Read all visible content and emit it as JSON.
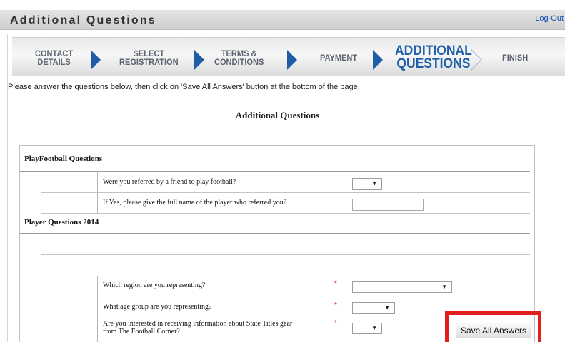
{
  "header": {
    "title": "Additional Questions",
    "logout_label": "Log-Out"
  },
  "steps": [
    {
      "line1": "CONTACT",
      "line2": "DETAILS",
      "active": false
    },
    {
      "line1": "SELECT",
      "line2": "REGISTRATION",
      "active": false
    },
    {
      "line1": "TERMS &",
      "line2": "CONDITIONS",
      "active": false
    },
    {
      "line1": "PAYMENT",
      "line2": "",
      "active": false
    },
    {
      "line1": "ADDITIONAL",
      "line2": "QUESTIONS",
      "active": true
    },
    {
      "line1": "FINISH",
      "line2": "",
      "active": false
    }
  ],
  "instructions": "Please answer the questions below, then click on 'Save All Answers' button at the bottom of the page.",
  "section_heading": "Additional Questions",
  "groups": [
    {
      "title": "PlayFootball Questions",
      "questions": [
        {
          "text": "Were you referred by a friend to play football?",
          "required": false,
          "input": "select",
          "value": ""
        },
        {
          "text": "If Yes, please give the full name of the player who referred you?",
          "required": false,
          "input": "text",
          "value": ""
        }
      ]
    },
    {
      "title": "Player Questions 2014",
      "questions": [
        {
          "text": "Which region are you representing?",
          "required": true,
          "input": "select",
          "value": ""
        },
        {
          "text": "What age group are you representing?",
          "required": true,
          "input": "select",
          "value": ""
        },
        {
          "text_line1": "Are you interested in receiving information about State Titles gear",
          "text_line2": "from The Football Corner?",
          "required": true,
          "input": "select",
          "value": ""
        }
      ]
    }
  ],
  "required_marker": "*",
  "save_button_label": "Save All Answers",
  "colors": {
    "active_step": "#1e5fa8",
    "step_arrow": "#1f5ea6",
    "highlight": "#e31e1e",
    "required": "#cc2222"
  }
}
